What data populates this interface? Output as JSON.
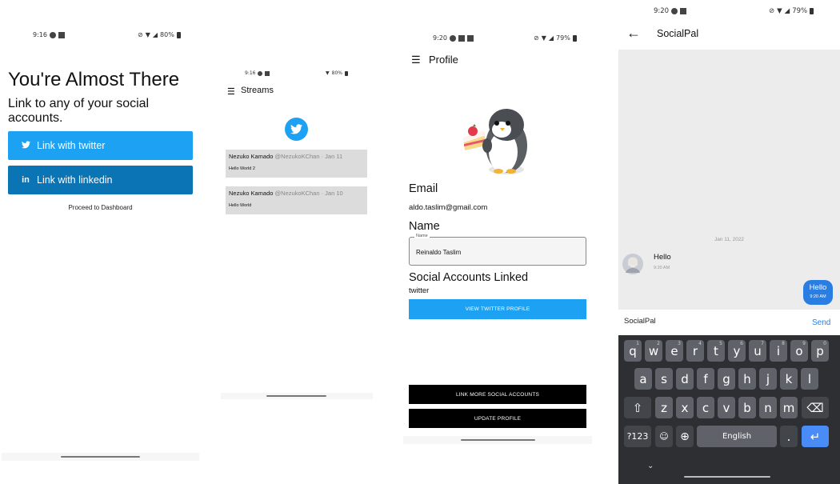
{
  "screen1": {
    "status": {
      "time": "9:16",
      "battery": "80%"
    },
    "title": "You're Almost There",
    "subtitle": "Link to any of your social accounts.",
    "twitter_button": "Link with twitter",
    "linkedin_button": "Link with linkedin",
    "dashboard_link": "Proceed to Dashboard",
    "colors": {
      "twitter": "#1da1f2",
      "linkedin": "#0a74b5"
    }
  },
  "screen2": {
    "status": {
      "time": "9:16",
      "battery": "80%"
    },
    "title": "Streams",
    "tweets": [
      {
        "name": "Nezuko Kamado",
        "handle": "@NezukoKChan · Jan 11",
        "text": "Hello World 2"
      },
      {
        "name": "Nezuko Kamado",
        "handle": "@NezukoKChan · Jan 10",
        "text": "Hello World"
      }
    ]
  },
  "screen3": {
    "status": {
      "time": "9:20",
      "battery": "79%"
    },
    "title": "Profile",
    "email_label": "Email",
    "email_value": "aldo.taslim@gmail.com",
    "name_label": "Name",
    "name_field_label": "Name",
    "name_field_value": "Reinaldo Taslim",
    "social_label": "Social Accounts Linked",
    "social_value": "twitter",
    "view_twitter_button": "VIEW TWITTER PROFILE",
    "link_more_button": "LINK MORE SOCIAL ACCOUNTS",
    "update_button": "UPDATE PROFILE"
  },
  "screen4": {
    "status": {
      "time": "9:20",
      "battery": "79%"
    },
    "title": "SocialPal",
    "date_divider": "Jan 11, 2022",
    "incoming": {
      "text": "Hello",
      "time": "9:20 AM"
    },
    "outgoing": {
      "text": "Hello",
      "time": "9:20 AM"
    },
    "input_value": "SocialPal",
    "send_label": "Send",
    "keyboard": {
      "row1": [
        "q",
        "w",
        "e",
        "r",
        "t",
        "y",
        "u",
        "i",
        "o",
        "p"
      ],
      "row1_hints": [
        "1",
        "2",
        "3",
        "4",
        "5",
        "6",
        "7",
        "8",
        "9",
        "0"
      ],
      "row2": [
        "a",
        "s",
        "d",
        "f",
        "g",
        "h",
        "j",
        "k",
        "l"
      ],
      "row3": [
        "z",
        "x",
        "c",
        "v",
        "b",
        "n",
        "m"
      ],
      "symbols_key": "?123",
      "space_label": "English",
      "period_key": "."
    }
  }
}
